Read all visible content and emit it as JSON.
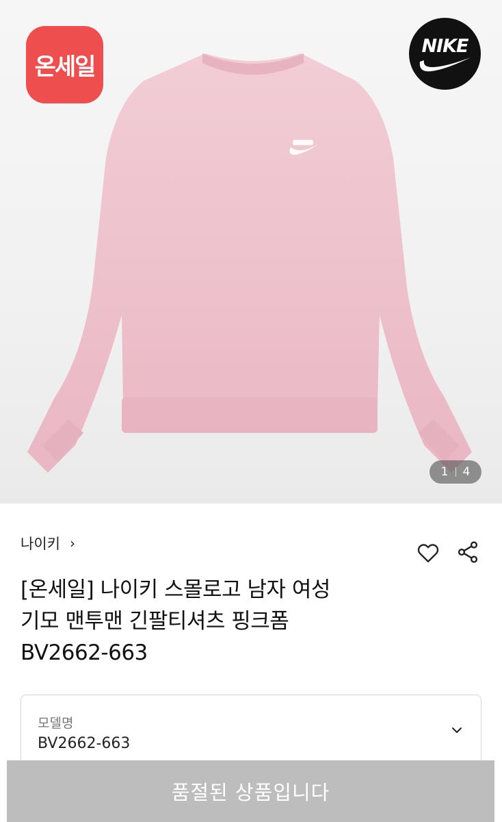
{
  "badge": {
    "text": "온세일"
  },
  "brand_logo": {
    "text": "NIKE"
  },
  "gallery": {
    "current": "1",
    "total": "4"
  },
  "brand": {
    "name": "나이키",
    "chevron": "›"
  },
  "actions": {
    "like_icon": "heart-icon",
    "share_icon": "share-icon"
  },
  "product": {
    "title_lines": [
      "[온세일] 나이키 스몰로고 남자 여성",
      "기모 맨투맨 긴팔티셔츠 핑크폼",
      "BV2662-663"
    ],
    "color": "#f0c6d0"
  },
  "option": {
    "label": "모델명",
    "value": "BV2662-663"
  },
  "button": {
    "soldout_label": "품절된 상품입니다"
  },
  "colors": {
    "badge_bg": "#ee4e4e",
    "button_bg": "#bdbdbd"
  }
}
